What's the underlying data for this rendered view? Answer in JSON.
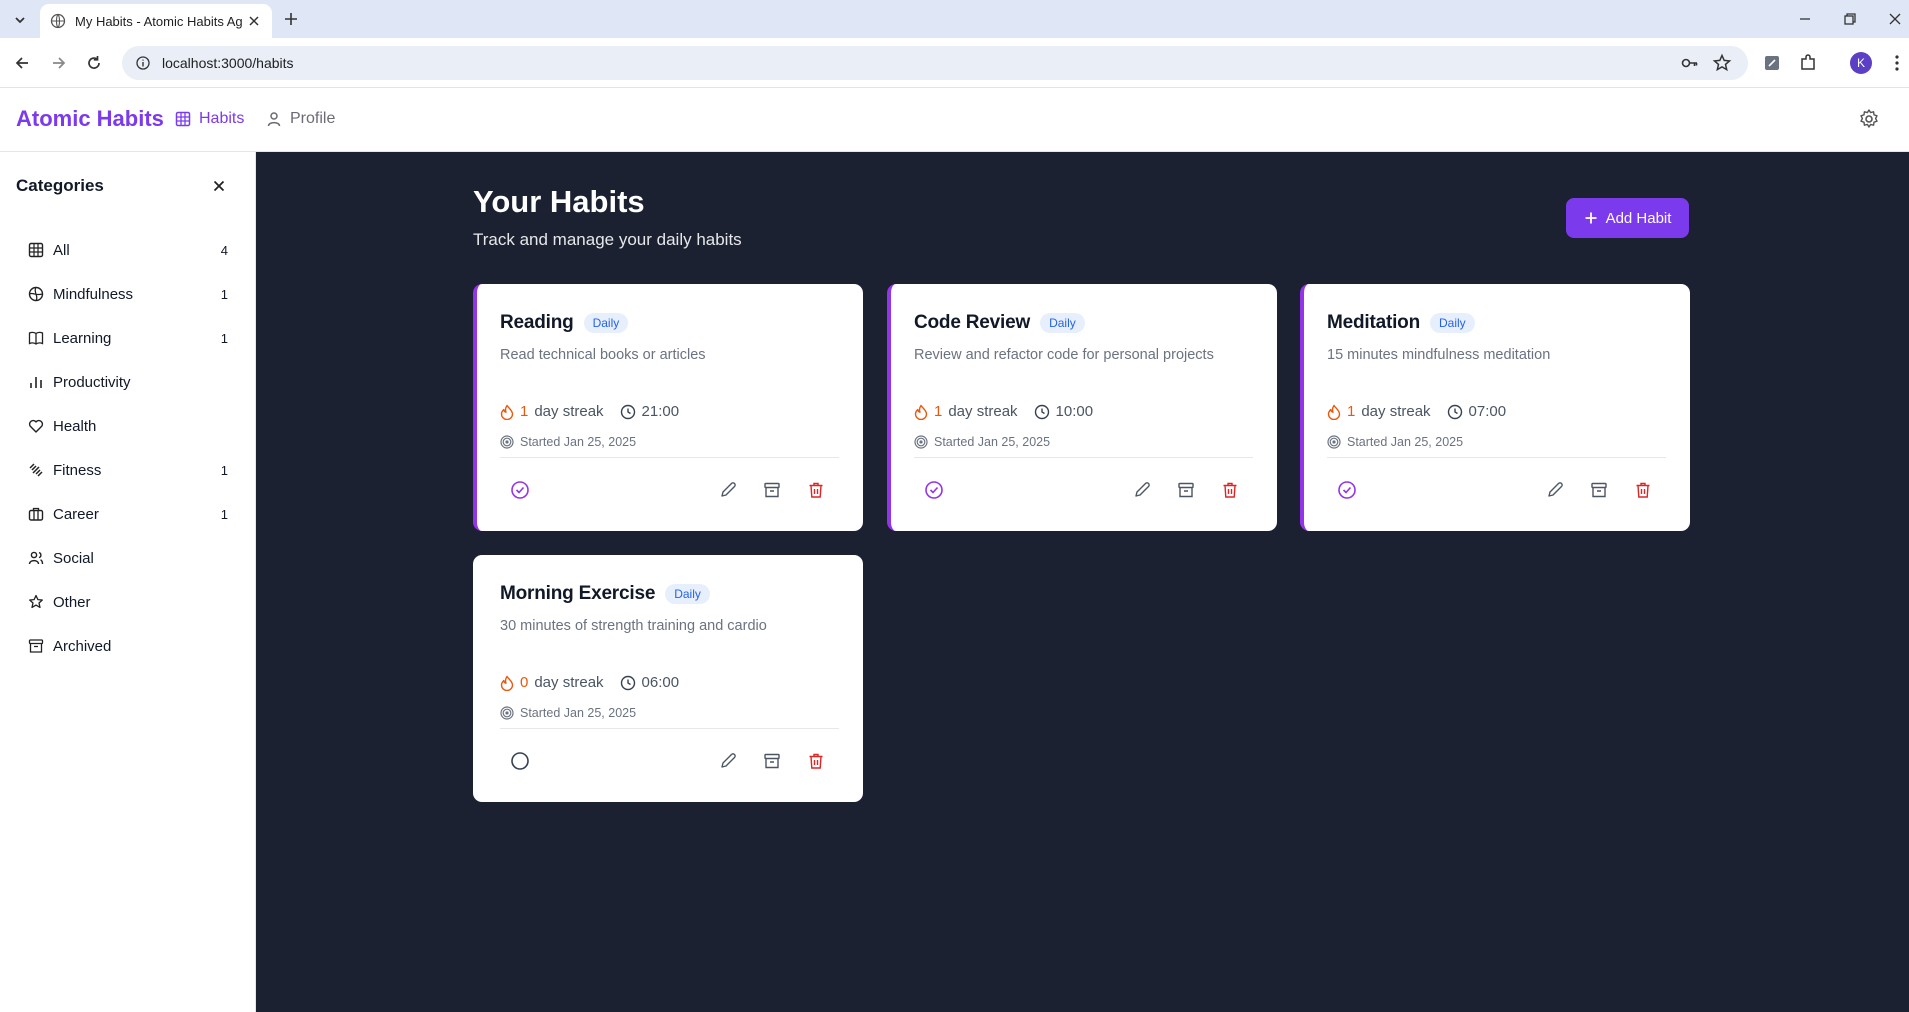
{
  "browser": {
    "tab_title": "My Habits - Atomic Habits Agent",
    "url": "localhost:3000/habits",
    "profile_initial": "K"
  },
  "header": {
    "brand": "Atomic Habits",
    "nav": [
      {
        "label": "Habits",
        "icon": "grid-icon",
        "active": true
      },
      {
        "label": "Profile",
        "icon": "user-icon",
        "active": false
      }
    ]
  },
  "sidebar": {
    "title": "Categories",
    "items": [
      {
        "label": "All",
        "count": "4",
        "icon": "grid-icon"
      },
      {
        "label": "Mindfulness",
        "count": "1",
        "icon": "globe-icon"
      },
      {
        "label": "Learning",
        "count": "1",
        "icon": "book-icon"
      },
      {
        "label": "Productivity",
        "count": "",
        "icon": "bar-chart-icon"
      },
      {
        "label": "Health",
        "count": "",
        "icon": "heart-icon"
      },
      {
        "label": "Fitness",
        "count": "1",
        "icon": "dumbbell-icon"
      },
      {
        "label": "Career",
        "count": "1",
        "icon": "briefcase-icon"
      },
      {
        "label": "Social",
        "count": "",
        "icon": "users-icon"
      },
      {
        "label": "Other",
        "count": "",
        "icon": "star-icon"
      },
      {
        "label": "Archived",
        "count": "",
        "icon": "archive-icon"
      }
    ]
  },
  "main": {
    "title": "Your Habits",
    "subtitle": "Track and manage your daily habits",
    "add_label": "Add Habit"
  },
  "habits": [
    {
      "name": "Reading",
      "frequency": "Daily",
      "description": "Read technical books or articles",
      "streak": "1",
      "streak_label": "day streak",
      "time": "21:00",
      "started": "Started Jan 25, 2025",
      "completed": true
    },
    {
      "name": "Code Review",
      "frequency": "Daily",
      "description": "Review and refactor code for personal projects",
      "streak": "1",
      "streak_label": "day streak",
      "time": "10:00",
      "started": "Started Jan 25, 2025",
      "completed": true
    },
    {
      "name": "Meditation",
      "frequency": "Daily",
      "description": "15 minutes mindfulness meditation",
      "streak": "1",
      "streak_label": "day streak",
      "time": "07:00",
      "started": "Started Jan 25, 2025",
      "completed": true
    },
    {
      "name": "Morning Exercise",
      "frequency": "Daily",
      "description": "30 minutes of strength training and cardio",
      "streak": "0",
      "streak_label": "day streak",
      "time": "06:00",
      "started": "Started Jan 25, 2025",
      "completed": false
    }
  ],
  "colors": {
    "accent": "#7c3aed",
    "background": "#1b2130",
    "streak": "#ea580c",
    "danger": "#dc2626",
    "badge_text": "#2563eb"
  }
}
